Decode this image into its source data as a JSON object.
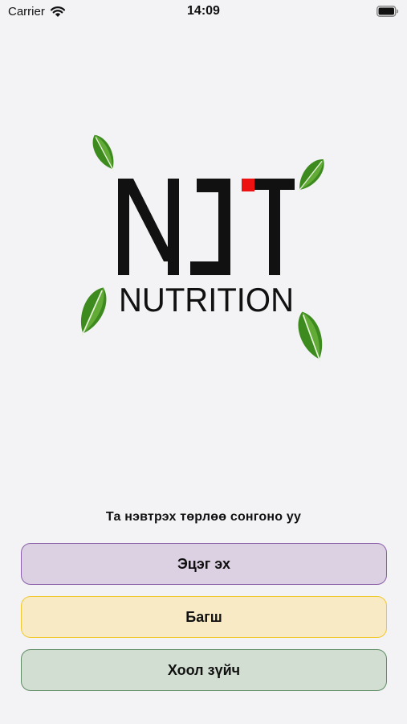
{
  "status_bar": {
    "carrier": "Carrier",
    "time": "14:09",
    "icons": [
      "wifi-icon",
      "battery-icon"
    ]
  },
  "logo": {
    "brand_text": "NUTRITION",
    "colors": {
      "text": "#111111",
      "accent": "#ee1111",
      "leaf": "#3d8b1e"
    }
  },
  "login": {
    "prompt": "Та нэвтрэх төрлөө сонгоно уу",
    "options": [
      {
        "label": "Эцэг эх",
        "background": "#dcd1e3",
        "border": "#8a5fa8"
      },
      {
        "label": "Багш",
        "background": "#f7eac5",
        "border": "#f1c92f"
      },
      {
        "label": "Хоол зүйч",
        "background": "#d3ded3",
        "border": "#5e8c65"
      }
    ]
  }
}
